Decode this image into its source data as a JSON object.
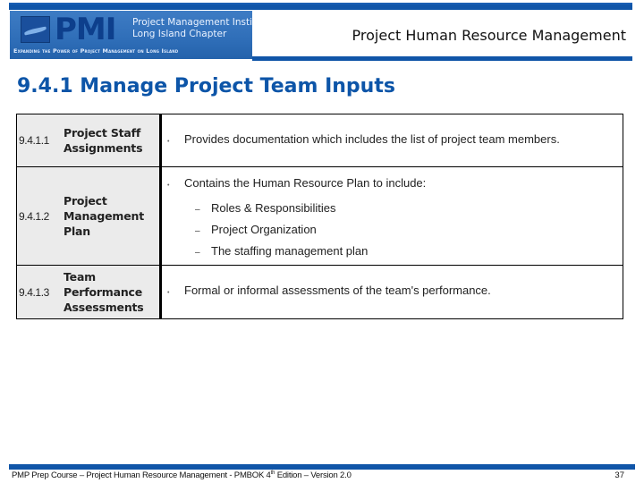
{
  "header": {
    "logo": {
      "mark": "PMI",
      "line1": "Project Management Institute",
      "line2": "Long Island Chapter",
      "tagline": "Expanding the Power of Project Management on Long Island"
    },
    "title": "Project Human Resource Management"
  },
  "slide": {
    "title": "9.4.1 Manage Project Team Inputs",
    "rows": [
      {
        "number": "9.4.1.1",
        "name_lines": [
          "Project Staff",
          "Assignments"
        ],
        "bullet": "Provides documentation which includes the list of project team members.",
        "sub_items": []
      },
      {
        "number": "9.4.1.2",
        "name_lines": [
          "Project",
          "Management",
          "Plan"
        ],
        "bullet": "Contains the Human Resource Plan to include:",
        "sub_items": [
          "Roles & Responsibilities",
          "Project Organization",
          "The staffing management plan"
        ]
      },
      {
        "number": "9.4.1.3",
        "name_lines": [
          "Team",
          "Performance",
          "Assessments"
        ],
        "bullet": "Formal or informal assessments of the team's performance.",
        "sub_items": []
      }
    ],
    "bullet_glyph": "•",
    "sub_glyph": "–"
  },
  "footer": {
    "text_pre": "PMP Prep Course – Project Human Resource Management - PMBOK 4",
    "text_sup": "th",
    "text_post": " Edition – Version 2.0",
    "page_number": "37"
  },
  "colors": {
    "brand_blue": "#1055a8",
    "title_blue": "#0d55a8",
    "cell_gray": "#ebebeb"
  }
}
